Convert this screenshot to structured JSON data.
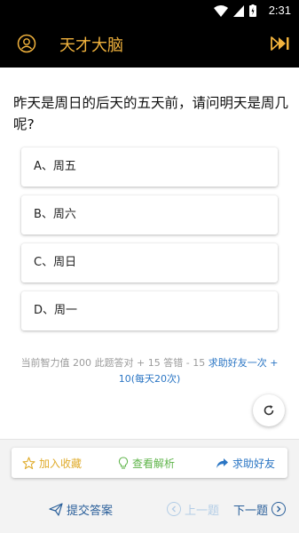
{
  "status_bar": {
    "time": "2:31"
  },
  "app_bar": {
    "title": "天才大脑"
  },
  "question": {
    "text": "昨天是周日的后天的五天前，请问明天是周几呢?"
  },
  "options": [
    {
      "label": "A、周五"
    },
    {
      "label": "B、周六"
    },
    {
      "label": "C、周日"
    },
    {
      "label": "D、周一"
    }
  ],
  "info": {
    "stats_text": "当前智力值 200 此题答对 + 15 答错 - 15 ",
    "help_text": "求助好友一次 + 10(每天20次)"
  },
  "actions": {
    "favorite": "加入收藏",
    "view_analysis": "查看解析",
    "ask_friend": "求助好友"
  },
  "bottom_nav": {
    "submit": "提交答案",
    "prev": "上一题",
    "next": "下一题"
  },
  "colors": {
    "accent_gold": "#f2b33d",
    "link_blue": "#2b76c4",
    "green": "#5fb44a"
  }
}
